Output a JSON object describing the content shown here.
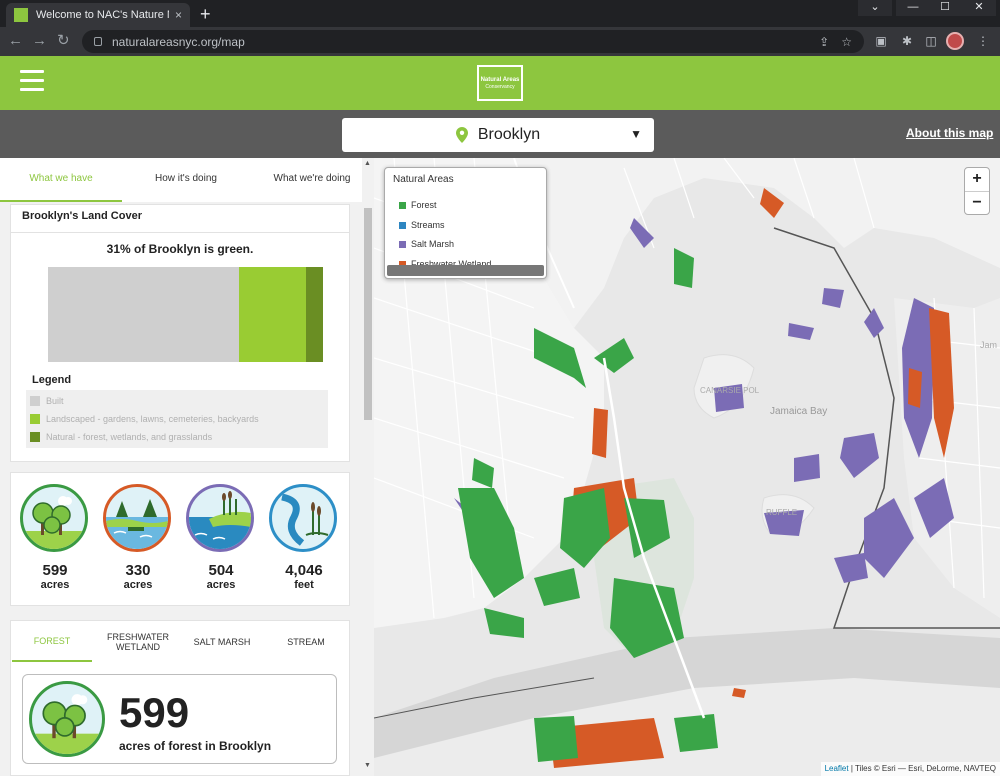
{
  "browser": {
    "tab_title": "Welcome to NAC's Nature Map!",
    "tab_close": "×",
    "new_tab": "+",
    "url": "naturalareasnyc.org/map",
    "window_controls": [
      "⌄",
      "—",
      "☐",
      "✕"
    ]
  },
  "header": {
    "logo_line1": "Natural Areas",
    "logo_line2": "Conservancy"
  },
  "subheader": {
    "borough": "Brooklyn",
    "about_link": "About this map"
  },
  "panel": {
    "tabs": [
      "What we have",
      "How it's doing",
      "What we're doing"
    ],
    "land_cover": {
      "title": "Brooklyn's Land Cover",
      "summary": "31% of Brooklyn is green.",
      "legend_title": "Legend",
      "legend": [
        {
          "label": "Built",
          "color": "#cfcfcf"
        },
        {
          "label": "Landscaped - gardens, lawns, cemeteries, backyards",
          "color": "#99cc33"
        },
        {
          "label": "Natural - forest, wetlands, and grasslands",
          "color": "#6a8e23"
        }
      ]
    },
    "stats": [
      {
        "icon": "forest-icon",
        "value": "599",
        "unit": "acres",
        "border": "#3a9a43"
      },
      {
        "icon": "freshwater-wetland-icon",
        "value": "330",
        "unit": "acres",
        "border": "#d65a26"
      },
      {
        "icon": "salt-marsh-icon",
        "value": "504",
        "unit": "acres",
        "border": "#7b6cb5"
      },
      {
        "icon": "stream-icon",
        "value": "4,046",
        "unit": "feet",
        "border": "#2d8fc7"
      }
    ],
    "feature_tabs": [
      "FOREST",
      "FRESHWATER WETLAND",
      "SALT MARSH",
      "STREAM"
    ],
    "detail": {
      "value": "599",
      "text": "acres of forest in Brooklyn"
    }
  },
  "map": {
    "legend_title": "Natural Areas",
    "legend_items": [
      {
        "label": "Forest",
        "color": "#3aa548"
      },
      {
        "label": "Streams",
        "color": "#2e86c1"
      },
      {
        "label": "Salt Marsh",
        "color": "#7b6cb5"
      },
      {
        "label": "Freshwater Wetland",
        "color": "#d65a26"
      }
    ],
    "zoom_in": "+",
    "zoom_out": "−",
    "labels": [
      "Jamaica Bay",
      "CANARSIE POL",
      "RUFFLE",
      "Jam"
    ],
    "attribution_leaflet": "Leaflet",
    "attribution_rest": " | Tiles © Esri — Esri, DeLorme, NAVTEQ"
  }
}
